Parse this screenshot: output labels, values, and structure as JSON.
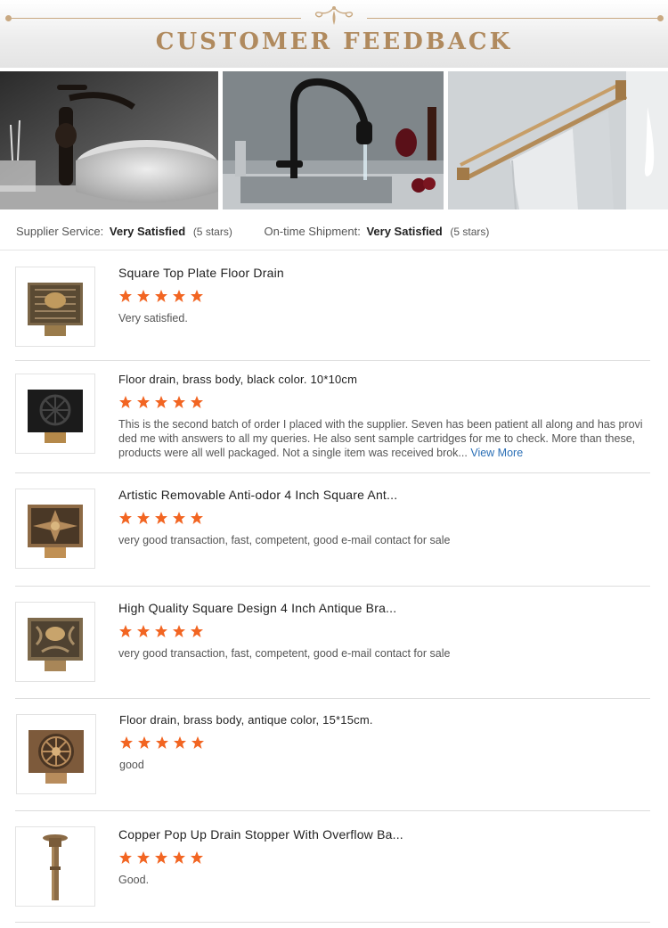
{
  "banner": {
    "title": "CUSTOMER FEEDBACK"
  },
  "summary": [
    {
      "label": "Supplier Service:",
      "value": "Very Satisfied",
      "stars": "(5 stars)"
    },
    {
      "label": "On-time Shipment:",
      "value": "Very Satisfied",
      "stars": "(5 stars)"
    }
  ],
  "reviews": [
    {
      "title": "Square Top Plate Floor Drain",
      "rating": 5,
      "body": "Very satisfied.",
      "thumb": "square-floor-drain-icon"
    },
    {
      "title": "Floor drain, brass body, black color. 10*10cm",
      "rating": 5,
      "body": "This is the second batch of order I placed with the supplier. Seven has been patient all along and has provided me with answers to all my queries. He also sent sample cartridges for me to check. More than these, products were all well packaged. Not a single item was received brok...",
      "more": "View More",
      "thumb": "black-floor-drain-icon"
    },
    {
      "title": "Artistic Removable Anti-odor 4 Inch Square Ant...",
      "rating": 5,
      "body": "very good transaction, fast, competent, good e-mail contact for sale",
      "thumb": "antique-floor-drain-icon"
    },
    {
      "title": "High Quality Square Design 4 Inch Antique Bra...",
      "rating": 5,
      "body": "very good transaction, fast, competent, good e-mail contact for sale",
      "thumb": "antique-brass-drain-icon"
    },
    {
      "title": "Floor drain, brass body, antique color, 15*15cm.",
      "rating": 5,
      "body": "good",
      "thumb": "round-pattern-drain-icon"
    },
    {
      "title": "Copper Pop Up Drain Stopper With Overflow Ba...",
      "rating": 5,
      "body": "Good.",
      "thumb": "pop-up-drain-stopper-icon"
    }
  ],
  "colors": {
    "accent_gold": "#b08a5e",
    "star_orange": "#f26522",
    "link_blue": "#2a6fb6"
  }
}
